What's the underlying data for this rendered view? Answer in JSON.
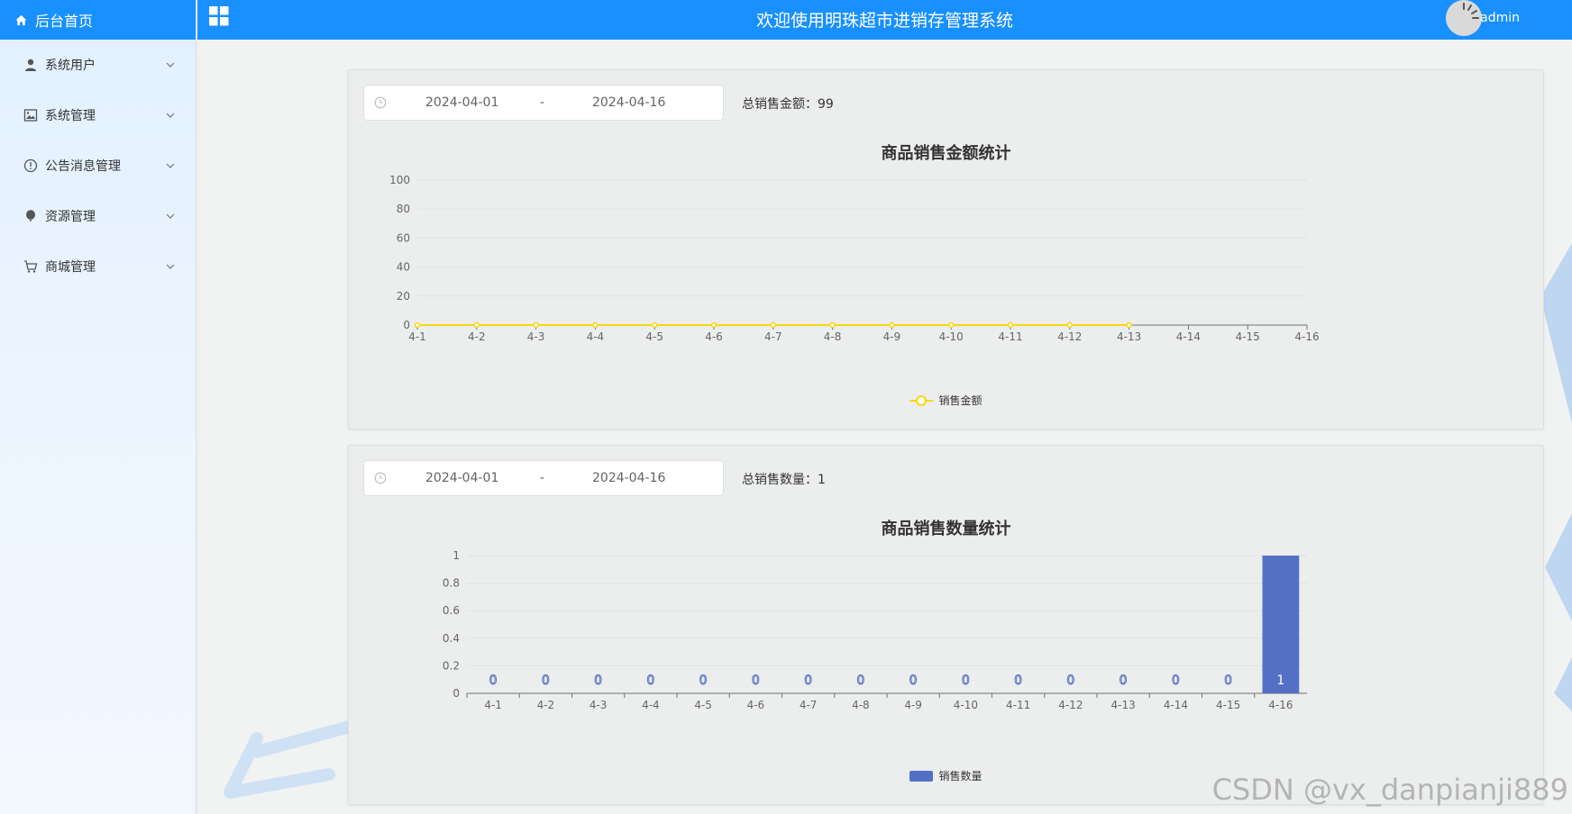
{
  "app": {
    "title": "欢迎使用明珠超市进销存管理系统",
    "username": "admin",
    "brand_color": "#1890ff"
  },
  "sidebar": {
    "home_label": "后台首页",
    "items": [
      {
        "label": "系统用户",
        "icon": "user-icon"
      },
      {
        "label": "系统管理",
        "icon": "picture-icon"
      },
      {
        "label": "公告消息管理",
        "icon": "info-icon"
      },
      {
        "label": "资源管理",
        "icon": "balloon-icon"
      },
      {
        "label": "商城管理",
        "icon": "cart-icon"
      }
    ]
  },
  "amount_panel": {
    "date_start": "2024-04-01",
    "date_sep": "-",
    "date_end": "2024-04-16",
    "total_label": "总销售金额：",
    "total_value": "99"
  },
  "quantity_panel": {
    "date_start": "2024-04-01",
    "date_sep": "-",
    "date_end": "2024-04-16",
    "total_label": "总销售数量：",
    "total_value": "1"
  },
  "chart_data": [
    {
      "type": "line",
      "title": "商品销售金额统计",
      "categories": [
        "4-1",
        "4-2",
        "4-3",
        "4-4",
        "4-5",
        "4-6",
        "4-7",
        "4-8",
        "4-9",
        "4-10",
        "4-11",
        "4-12",
        "4-13",
        "4-14",
        "4-15",
        "4-16"
      ],
      "y_ticks": [
        "0",
        "20",
        "40",
        "60",
        "80",
        "100"
      ],
      "ylim": [
        0,
        100
      ],
      "series": [
        {
          "name": "销售金额",
          "color": "#f5d80f",
          "values": [
            0,
            0,
            0,
            0,
            0,
            0,
            0,
            0,
            0,
            0,
            0,
            0,
            0
          ]
        }
      ],
      "grid": true,
      "legend": "bottom-center"
    },
    {
      "type": "bar",
      "title": "商品销售数量统计",
      "categories": [
        "4-1",
        "4-2",
        "4-3",
        "4-4",
        "4-5",
        "4-6",
        "4-7",
        "4-8",
        "4-9",
        "4-10",
        "4-11",
        "4-12",
        "4-13",
        "4-14",
        "4-15",
        "4-16"
      ],
      "y_ticks": [
        "0",
        "0.2",
        "0.4",
        "0.6",
        "0.8",
        "1"
      ],
      "ylim": [
        0,
        1
      ],
      "series": [
        {
          "name": "销售数量",
          "color": "#5470c6",
          "values": [
            0,
            0,
            0,
            0,
            0,
            0,
            0,
            0,
            0,
            0,
            0,
            0,
            0,
            0,
            0,
            1
          ]
        }
      ],
      "data_labels": [
        "0",
        "0",
        "0",
        "0",
        "0",
        "0",
        "0",
        "0",
        "0",
        "0",
        "0",
        "0",
        "0",
        "0",
        "0",
        "1"
      ],
      "grid": true,
      "legend": "bottom-center"
    }
  ],
  "watermark": "CSDN @vx_danpianji889"
}
